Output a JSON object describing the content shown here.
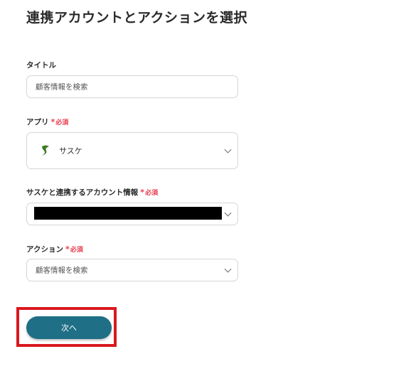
{
  "header": {
    "title": "連携アカウントとアクションを選択"
  },
  "form": {
    "title_field": {
      "label": "タイトル",
      "value": "顧客情報を検索"
    },
    "app_field": {
      "label": "アプリ",
      "required_mark": "*",
      "required_label": "必須",
      "value": "サスケ",
      "icon": "sasuke-logo-icon"
    },
    "account_field": {
      "label": "サスケと連携するアカウント情報",
      "required_mark": "*",
      "required_label": "必須",
      "value_redacted": true
    },
    "action_field": {
      "label": "アクション",
      "required_mark": "*",
      "required_label": "必須",
      "value": "顧客情報を検索"
    }
  },
  "footer": {
    "next_label": "次へ"
  },
  "colors": {
    "accent": "#1f6f86",
    "required": "#e8394a",
    "highlight": "#d9181e",
    "app_icon": "#3d7a25"
  }
}
